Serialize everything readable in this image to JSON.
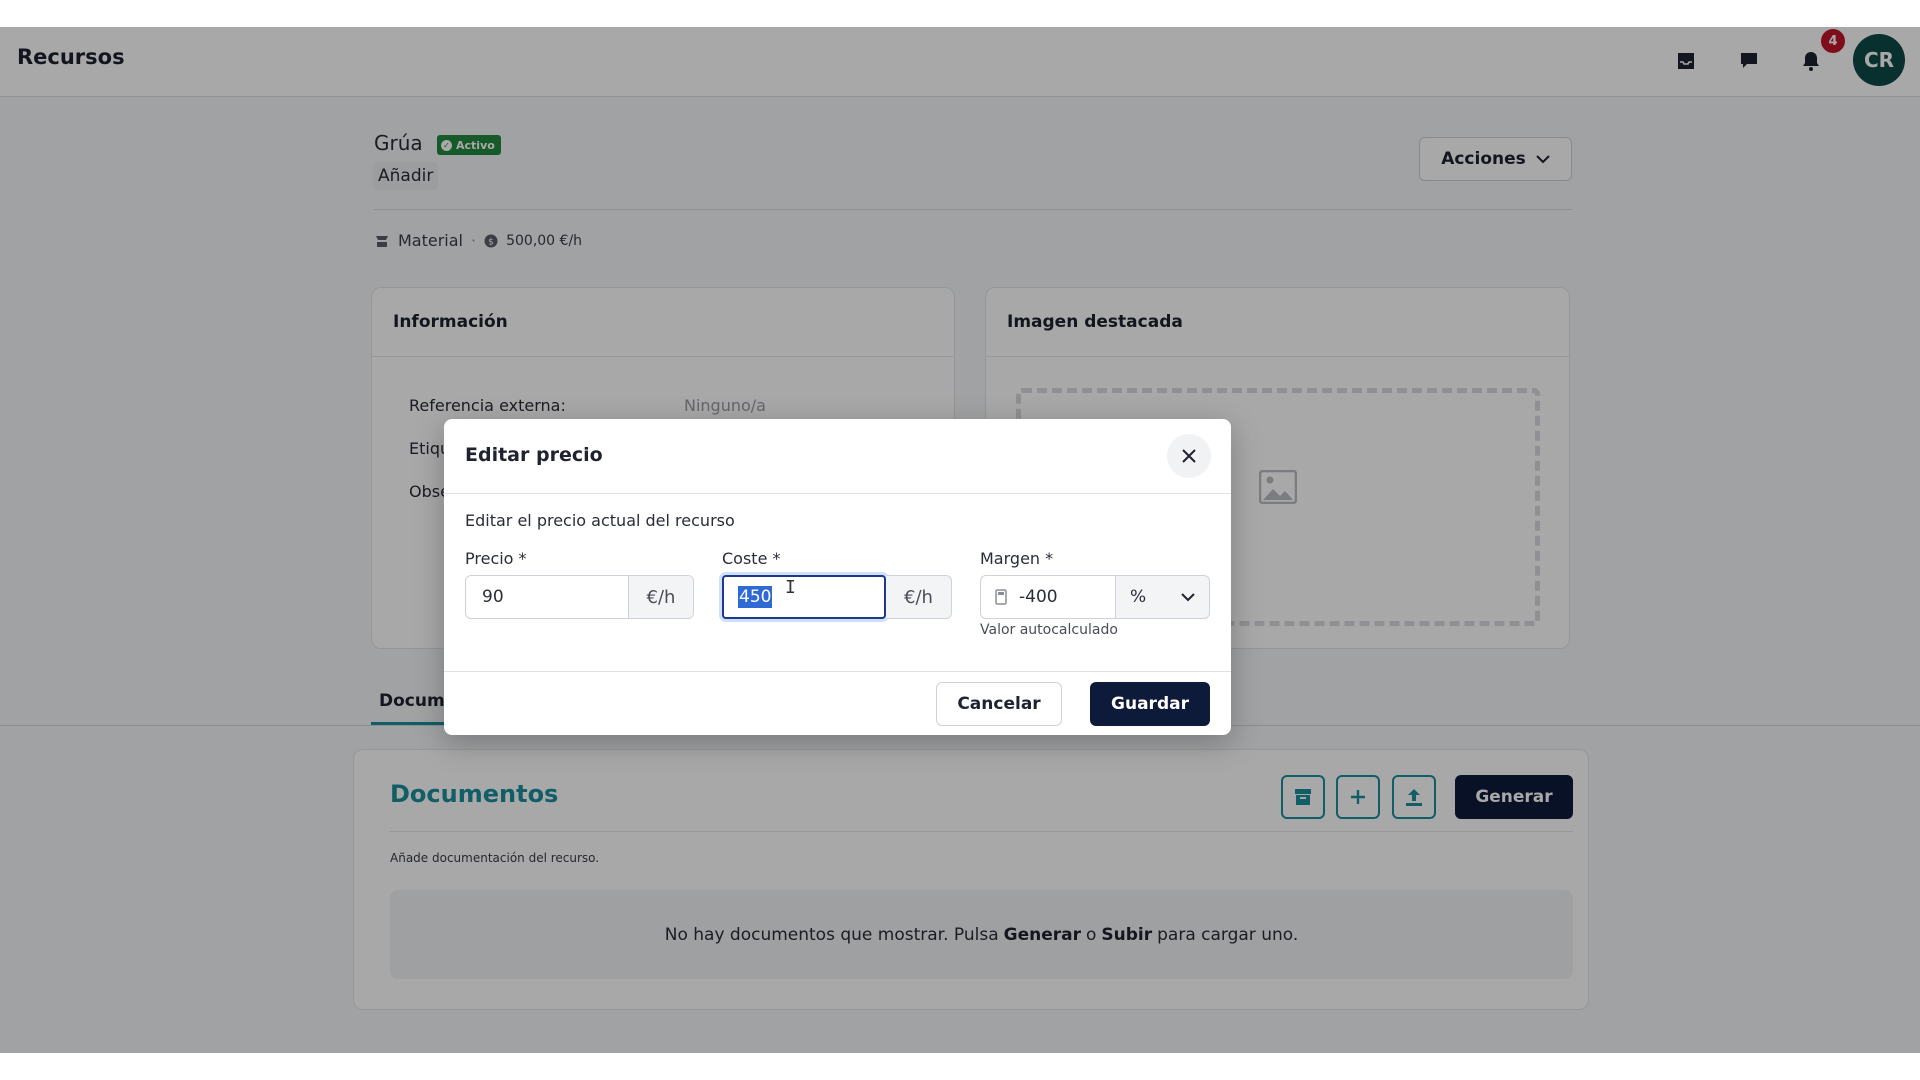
{
  "header": {
    "title": "Recursos",
    "notifications_count": "4",
    "avatar_initials": "CR",
    "icons": [
      "inbox-icon",
      "chat-icon",
      "bell-icon"
    ]
  },
  "resource": {
    "name": "Grúa",
    "status": "Activo",
    "add_label": "Añadir",
    "actions_label": "Acciones",
    "type": "Material",
    "price": "500,00 €/h"
  },
  "info_card": {
    "title": "Información",
    "rows": [
      {
        "label": "Referencia externa:",
        "value": "Ninguno/a"
      },
      {
        "label": "Etiqu",
        "value": ""
      },
      {
        "label": "Obse",
        "value": ""
      }
    ]
  },
  "image_card": {
    "title": "Imagen destacada"
  },
  "tabs": {
    "active": "Docum"
  },
  "documents": {
    "title": "Documentos",
    "subtitle": "Añade documentación del recurso.",
    "generate_label": "Generar",
    "empty_prefix": "No hay documentos que mostrar. Pulsa",
    "empty_generate": "Generar",
    "empty_or": "o",
    "empty_upload": "Subir",
    "empty_suffix": "para cargar uno."
  },
  "modal": {
    "title": "Editar precio",
    "description": "Editar el precio actual del recurso",
    "price_label": "Precio *",
    "price_value": "90",
    "price_unit": "€/h",
    "cost_label": "Coste *",
    "cost_value": "450",
    "cost_unit": "€/h",
    "margin_label": "Margen *",
    "margin_value": "-400",
    "margin_unit": "%",
    "margin_hint": "Valor autocalculado",
    "cancel_label": "Cancelar",
    "save_label": "Guardar"
  },
  "colors": {
    "accent": "#1a8f9c",
    "primary_dark": "#0e1a3a",
    "status_green": "#22893f",
    "badge_red": "#c3152a",
    "avatar_bg": "#0c4a46"
  }
}
